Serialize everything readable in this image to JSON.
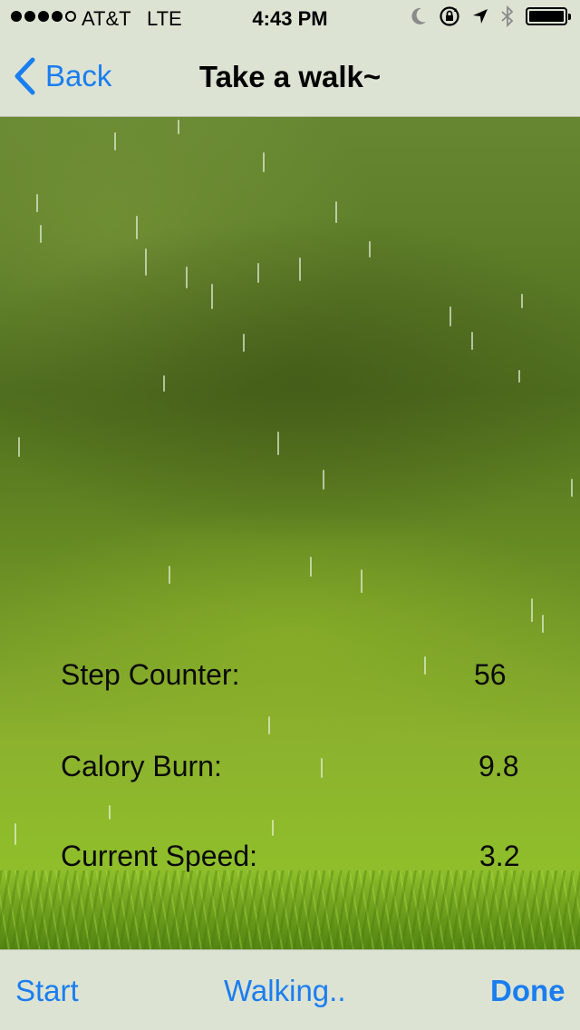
{
  "status_bar": {
    "carrier": "AT&T",
    "network": "LTE",
    "time": "4:43 PM",
    "icons": [
      "moon-icon",
      "rotation-lock-icon",
      "location-arrow-icon",
      "bluetooth-icon",
      "battery-icon"
    ]
  },
  "nav": {
    "back_label": "Back",
    "title": "Take a walk~"
  },
  "stats": {
    "step_counter_label": "Step Counter:",
    "step_counter_value": "56",
    "calory_burn_label": "Calory Burn:",
    "calory_burn_value": "9.8",
    "current_speed_label": "Current Speed:",
    "current_speed_value": "3.2"
  },
  "toolbar": {
    "start_label": "Start",
    "status_label": "Walking..",
    "done_label": "Done"
  },
  "colors": {
    "accent": "#1a7ef0",
    "bar_background": "#dde3d3"
  }
}
